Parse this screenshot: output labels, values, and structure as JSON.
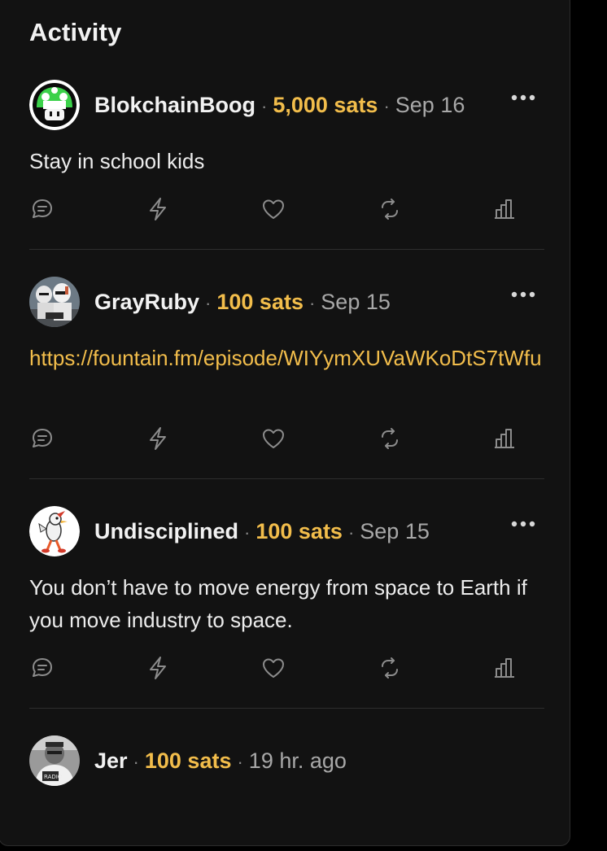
{
  "page": {
    "title": "Activity"
  },
  "colors": {
    "accent": "#f2bd4b",
    "panel_bg": "#121212",
    "divider": "#2e2e2e",
    "muted": "#a8a8a8"
  },
  "icons": {
    "more": "ellipsis-icon",
    "reply": "speech-bubble-icon",
    "zap": "lightning-icon",
    "like": "heart-icon",
    "repost": "repost-icon",
    "stats": "bar-chart-icon"
  },
  "posts": [
    {
      "author": "BlokchainBoog",
      "sats": "5,000 sats",
      "date": "Sep 16",
      "text": "Stay in school kids",
      "avatar": "mushroom-avatar"
    },
    {
      "author": "GrayRuby",
      "sats": "100 sats",
      "date": "Sep 15",
      "text": "https://fountain.fm/episode/WIYymXUVaWKoDtS7tWfu",
      "avatar": "stormtrooper-avatar"
    },
    {
      "author": "Undisciplined",
      "sats": "100 sats",
      "date": "Sep 15",
      "text": "You don’t have to move energy from space to Earth if you move industry to space.",
      "avatar": "cartoon-bird-avatar"
    },
    {
      "author": "Jer",
      "sats": "100 sats",
      "date": "19 hr. ago",
      "avatar": "grayscale-photo-avatar"
    }
  ]
}
